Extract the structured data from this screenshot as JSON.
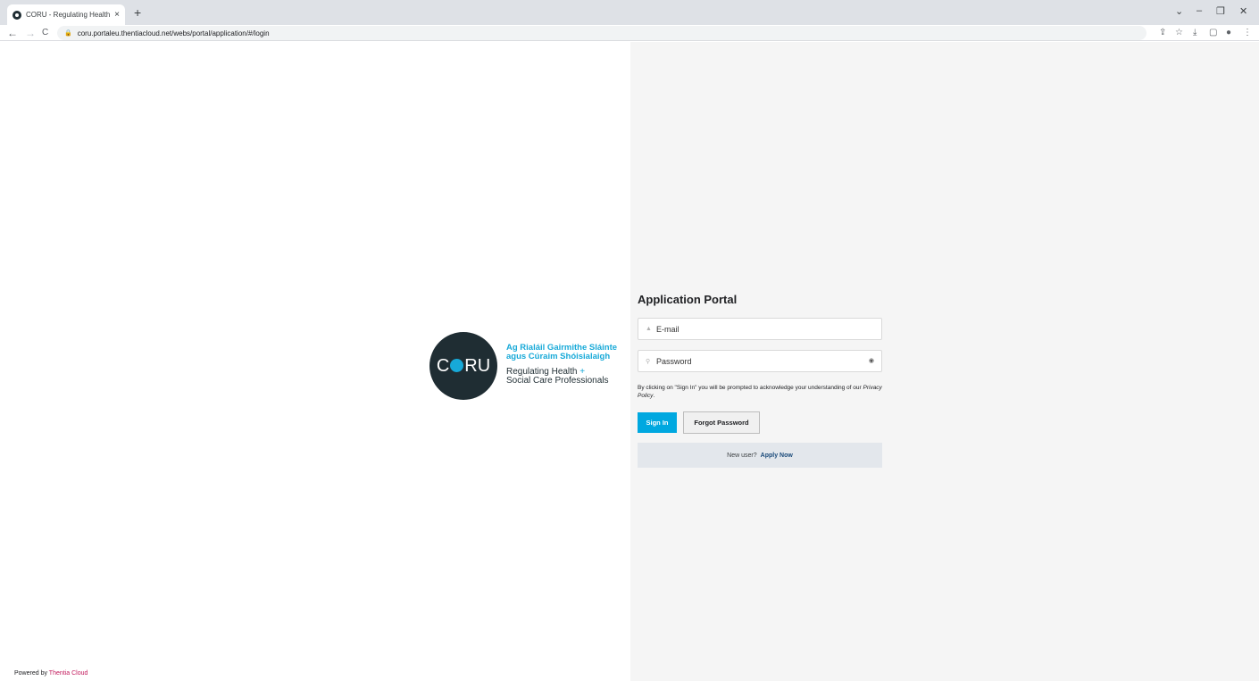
{
  "browser": {
    "tab_title": "CORU - Regulating Health & Soc",
    "tab_close": "×",
    "new_tab": "+",
    "url": "coru.portaleu.thentiacloud.net/webs/portal/application/#/login",
    "controls": {
      "dropdown": "⌄",
      "minimize": "–",
      "restore": "❐",
      "close": "✕"
    },
    "nav": {
      "back": "←",
      "forward": "→",
      "reload": "C"
    },
    "toolbar_icons": {
      "share": "⇪",
      "star": "☆",
      "download": "⤓",
      "sidepanel": "▢",
      "profile": "●",
      "menu": "⋮"
    }
  },
  "logo": {
    "wordmark_left": "C",
    "wordmark_right": "RU",
    "irish_line1": "Ag Rialáil Gairmithe Sláinte",
    "irish_line2": "agus Cúraim Shóisialaigh",
    "english_line1": "Regulating Health",
    "plus": "+",
    "english_line2": "Social Care Professionals"
  },
  "login": {
    "title": "Application Portal",
    "email_placeholder": "E-mail",
    "password_placeholder": "Password",
    "consent_text": "By clicking on \"Sign In\" you will be prompted to acknowledge your understanding of our",
    "privacy_link": "Privacy Policy",
    "consent_end": ".",
    "sign_in": "Sign In",
    "forgot_password": "Forgot Password",
    "new_user": "New user?",
    "apply_now": "Apply Now"
  },
  "footer": {
    "powered_by": "Powered by",
    "brand": "Thentia Cloud"
  },
  "colors": {
    "accent": "#00a8e0",
    "logo_dark": "#1f2d33",
    "logo_cyan": "#17a9d8",
    "footer_brand": "#c2185b"
  }
}
